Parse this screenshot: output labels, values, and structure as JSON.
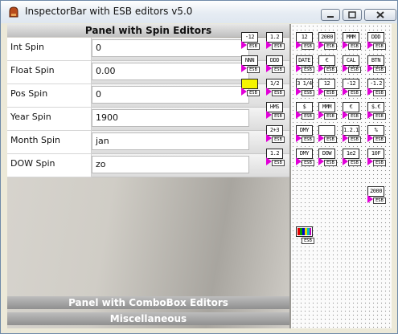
{
  "window": {
    "title": "InspectorBar with ESB editors v5.0"
  },
  "panels": {
    "spin": "Panel with Spin Editors",
    "combo": "Panel with ComboBox Editors",
    "misc": "Miscellaneous"
  },
  "rows": [
    {
      "label": "Int Spin",
      "value": "0"
    },
    {
      "label": "Float Spin",
      "value": "0.00"
    },
    {
      "label": "Pos Spin",
      "value": "0"
    },
    {
      "label": "Year Spin",
      "value": "1900"
    },
    {
      "label": "Month Spin",
      "value": "jan"
    },
    {
      "label": "DOW Spin",
      "value": "zo"
    }
  ],
  "header_tools": [
    {
      "glyph": "-12",
      "badge": "ESB"
    },
    {
      "glyph": "1.2",
      "badge": "ESB"
    },
    {
      "glyph": "NNN",
      "badge": "ESB"
    },
    {
      "glyph": "DDD",
      "badge": "ESB"
    },
    {
      "glyph": "",
      "badge": "ESB"
    },
    {
      "glyph": "1/2",
      "badge": "ESB"
    },
    {
      "glyph": "HMS",
      "badge": "ESB"
    },
    {
      "glyph": "2+3",
      "badge": "ESB"
    },
    {
      "glyph": "1.2",
      "badge": "ESB"
    }
  ],
  "palette": [
    {
      "glyph": "12",
      "badge": "ESB"
    },
    {
      "glyph": "2000",
      "badge": "ESB"
    },
    {
      "glyph": "MMM",
      "badge": "ESB"
    },
    {
      "glyph": "DDD",
      "badge": "ESB"
    },
    {
      "glyph": "DATE",
      "badge": "ESB"
    },
    {
      "glyph": "€",
      "badge": "ESB"
    },
    {
      "glyph": "CAL",
      "badge": "ESB"
    },
    {
      "glyph": "BTN",
      "badge": "ESB"
    },
    {
      "glyph": "3 1/4",
      "badge": "ESB"
    },
    {
      "glyph": "12",
      "badge": "ESB"
    },
    {
      "glyph": "-12",
      "badge": "ESB"
    },
    {
      "glyph": "-1.2",
      "badge": "ESB"
    },
    {
      "glyph": "$",
      "badge": "ESB"
    },
    {
      "glyph": "MMM",
      "badge": "ESB"
    },
    {
      "glyph": "€",
      "badge": "ESB"
    },
    {
      "glyph": "$.€",
      "badge": "ESB"
    },
    {
      "glyph": "DMY",
      "badge": "ESB"
    },
    {
      "glyph": "",
      "badge": "ESB"
    },
    {
      "glyph": "1.2.1",
      "badge": "ESB"
    },
    {
      "glyph": "%",
      "badge": "ESB"
    },
    {
      "glyph": "DMY",
      "badge": "ESB"
    },
    {
      "glyph": "DOW",
      "badge": "ESB"
    },
    {
      "glyph": "1e2",
      "badge": "ESB"
    },
    {
      "glyph": "10F",
      "badge": "ESB"
    },
    {
      "glyph": "2000",
      "badge": "ESB"
    },
    {
      "glyph": "",
      "badge": "ESB"
    }
  ],
  "colors": {
    "accent_arrow": "#e100d8",
    "pos_spin_yellow": "#f5f500"
  }
}
